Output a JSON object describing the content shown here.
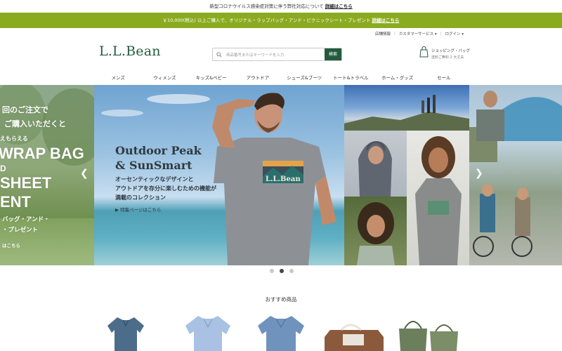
{
  "notice": {
    "text": "新型コロナウイルス感染症対策に伴う弊社対応について",
    "link": "詳細はこちら"
  },
  "promo": {
    "text": "￥10,000(税込) 以上ご購入で、オリジナル・ラップバッグ・アンド・ピクニックシート・プレゼント",
    "link": "詳細はこちら"
  },
  "utility": {
    "store": "店舗情報",
    "customer_service": "カスタマーサービス ▾",
    "login": "ログイン ▾"
  },
  "header": {
    "logo": "L.L.Bean",
    "search_placeholder": "商品番号またはキーワードを入力",
    "search_button": "検索",
    "bag_label": "ショッピング・バッグ",
    "bag_status": "送料ご無料 2 大丈夫"
  },
  "nav": [
    "メンズ",
    "ウィメンズ",
    "キッズ&ベビー",
    "アウトドア",
    "シューズ&ブーツ",
    "トート&トラベル",
    "ホーム・グッズ",
    "セール"
  ],
  "hero": {
    "left_slide": {
      "line1": "回のご注文で",
      "line2": "ご購入いただくと",
      "line3": "えもらえる",
      "line4": "WRAP BAG",
      "line5": "D",
      "line6": "SHEET",
      "line7": "ENT",
      "line8": "バッグ・アンド・",
      "line9": "・プレゼント",
      "line10": "はこちら"
    },
    "main_slide": {
      "headline1": "Outdoor Peak",
      "headline2": "& SunSmart",
      "desc1": "オーセンティックなデザインと",
      "desc2": "アウトドアを存分に楽しむための機能が",
      "desc3": "満載のコレクション",
      "link": "▶ 特集ページはこちら",
      "shirt_brand": "L.L.Bean"
    }
  },
  "carousel": {
    "prev": "❮",
    "next": "❯",
    "active_index": 1,
    "count": 3
  },
  "recommended": {
    "title": "おすすめ商品"
  },
  "colors": {
    "brand_green": "#235a3d",
    "promo_green": "#8aab1f"
  }
}
